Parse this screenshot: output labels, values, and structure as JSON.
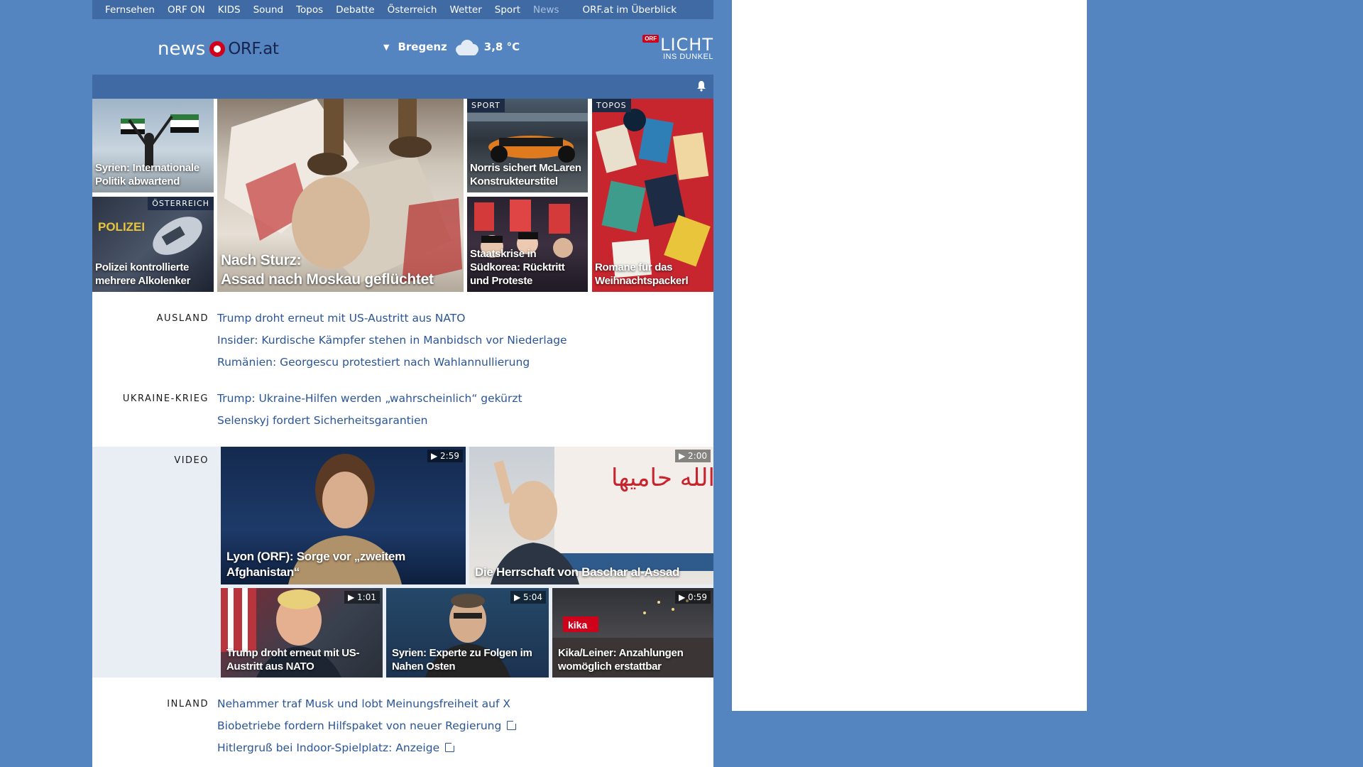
{
  "nav": {
    "items": [
      "Fernsehen",
      "ORF ON",
      "KIDS",
      "Sound",
      "Topos",
      "Debatte",
      "Österreich",
      "Wetter",
      "Sport",
      "News"
    ],
    "overview": "ORF.at im Überblick"
  },
  "header": {
    "logo_news": "news",
    "logo_orf": "ORF.at",
    "weather_location": "Bregenz",
    "weather_temp": "3,8 °C",
    "licht_badge": "ORF",
    "licht_big": "LICHT",
    "licht_small": "INS DUNKEL"
  },
  "tiles": {
    "t1": {
      "title": "Syrien: Internationale Politik abwartend"
    },
    "t2": {
      "tag": "ÖSTERREICH",
      "title": "Polizei kontrollierte mehrere Alkolenker"
    },
    "t3": {
      "title_line1": "Nach Sturz:",
      "title_line2": "Assad nach Moskau geflüchtet"
    },
    "t4": {
      "tag": "SPORT",
      "title": "Norris sichert McLaren Konstrukteurstitel"
    },
    "t5": {
      "title": "Staatskrise in Südkorea: Rücktritt und Proteste"
    },
    "t6": {
      "tag": "TOPOS",
      "title": "Romane für das Weihnachtspackerl"
    }
  },
  "sections": {
    "ausland": {
      "label": "AUSLAND",
      "links": [
        "Trump droht erneut mit US-Austritt aus NATO",
        "Insider: Kurdische Kämpfer stehen in Manbidsch vor Niederlage",
        "Rumänien: Georgescu protestiert nach Wahlannullierung"
      ]
    },
    "ukraine": {
      "label": "UKRAINE-KRIEG",
      "links": [
        "Trump: Ukraine-Hilfen werden „wahrscheinlich“ gekürzt",
        "Selenskyj fordert Sicherheitsgarantien"
      ]
    },
    "video": {
      "label": "VIDEO"
    },
    "inland": {
      "label": "INLAND",
      "links": [
        "Nehammer traf Musk und lobt Meinungsfreiheit auf X",
        "Biobetriebe fordern Hilfspaket von neuer Regierung",
        "Hitlergruß bei Indoor-Spielplatz: Anzeige"
      ]
    }
  },
  "videos": {
    "v1": {
      "duration": "2:59",
      "title": "Lyon (ORF): Sorge vor „zweitem Afghanistan“"
    },
    "v2": {
      "duration": "2:00",
      "title": "Die Herrschaft von Baschar al-Assad",
      "banner_text": "سوريا الله حاميها"
    },
    "v3": {
      "duration": "1:01",
      "title": "Trump droht erneut mit US-Austritt aus NATO"
    },
    "v4": {
      "duration": "5:04",
      "title": "Syrien: Experte zu Folgen im Nahen Osten"
    },
    "v5": {
      "duration": "0:59",
      "title": "Kika/Leiner: Anzahlungen womöglich erstattbar",
      "sign_text": "kika"
    }
  },
  "tile_extras": {
    "polizei_text": "POLIZEI"
  },
  "colors": {
    "page_bg": "#5585c1",
    "nav_bg": "#3f6aa3",
    "link": "#2a5597",
    "orf_red": "#d0021b"
  }
}
